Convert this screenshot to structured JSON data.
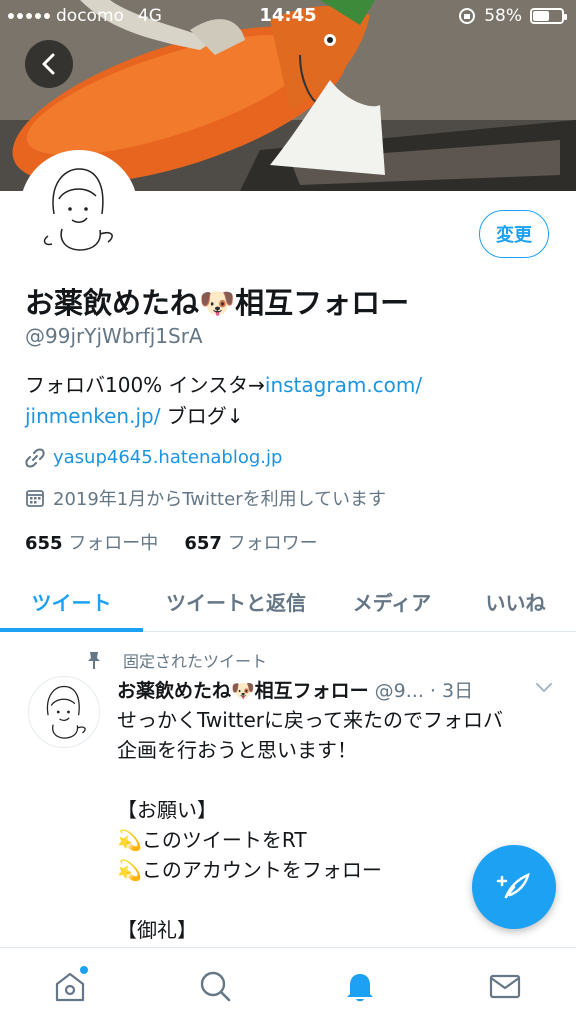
{
  "status_bar": {
    "carrier": "docomo",
    "network": "4G",
    "time": "14:45",
    "battery": "58%",
    "battery_level": 0.58
  },
  "profile": {
    "name": "お薬飲めたね🐶相互フォロー",
    "handle": "@99jrYjWbrfj1SrA",
    "edit_label": "変更",
    "bio_prefix": "フォロバ100% インスタ→",
    "bio_link_1": "instagram.com/",
    "bio_link_2": "jinmenken.jp/",
    "bio_suffix": " ブログ↓",
    "website": "yasup4645.hatenablog.jp",
    "joined": "2019年1月からTwitterを利用しています",
    "following_count": "655",
    "following_label": "フォロー中",
    "followers_count": "657",
    "followers_label": "フォロワー"
  },
  "tabs": [
    {
      "label": "ツイート",
      "active": true
    },
    {
      "label": "ツイートと返信",
      "active": false
    },
    {
      "label": "メディア",
      "active": false
    },
    {
      "label": "いいね",
      "active": false
    }
  ],
  "tweet": {
    "pinned_label": "固定されたツイート",
    "author": "お薬飲めたね🐶相互フォロー",
    "handle_time": "@9... · 3日",
    "lines": [
      "せっかくTwitterに戻って来たのでフォロバ",
      "企画を行おうと思います！",
      "",
      "【お願い】",
      "💫このツイートをRT",
      "💫このアカウントをフォロー",
      "",
      "【御礼】",
      "💫"
    ]
  },
  "colors": {
    "accent": "#1da1f2",
    "link": "#1b95e0",
    "secondary_text": "#657786"
  },
  "icons": {
    "back": "chevron-left-icon",
    "link": "link-icon",
    "calendar": "calendar-icon",
    "pin": "pin-icon",
    "chevron": "chevron-down-icon",
    "compose": "compose-feather-icon",
    "home": "home-icon",
    "search": "search-icon",
    "notifications": "bell-icon",
    "messages": "mail-icon"
  }
}
